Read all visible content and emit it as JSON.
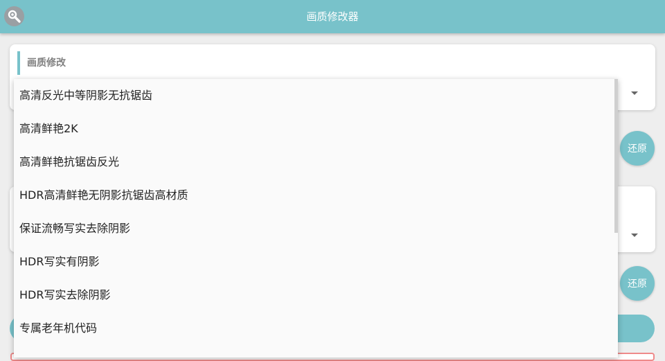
{
  "header": {
    "title": "画质修改器",
    "icon": "wrench-search-icon"
  },
  "section1": {
    "title": "画质修改"
  },
  "restore_buttons": [
    "还原",
    "还原"
  ],
  "dropdown": {
    "options": [
      "高清反光中等阴影无抗锯齿",
      "高清鲜艳2K",
      "高清鲜艳抗锯齿反光",
      "HDR高清鲜艳无阴影抗锯齿高材质",
      "保证流畅写实去除阴影",
      "HDR写实有阴影",
      "HDR写实去除阴影",
      "专属老年机代码"
    ]
  },
  "colors": {
    "accent": "#78c2ca",
    "background": "#eeeeee",
    "frame_red": "#ef8a8a"
  }
}
